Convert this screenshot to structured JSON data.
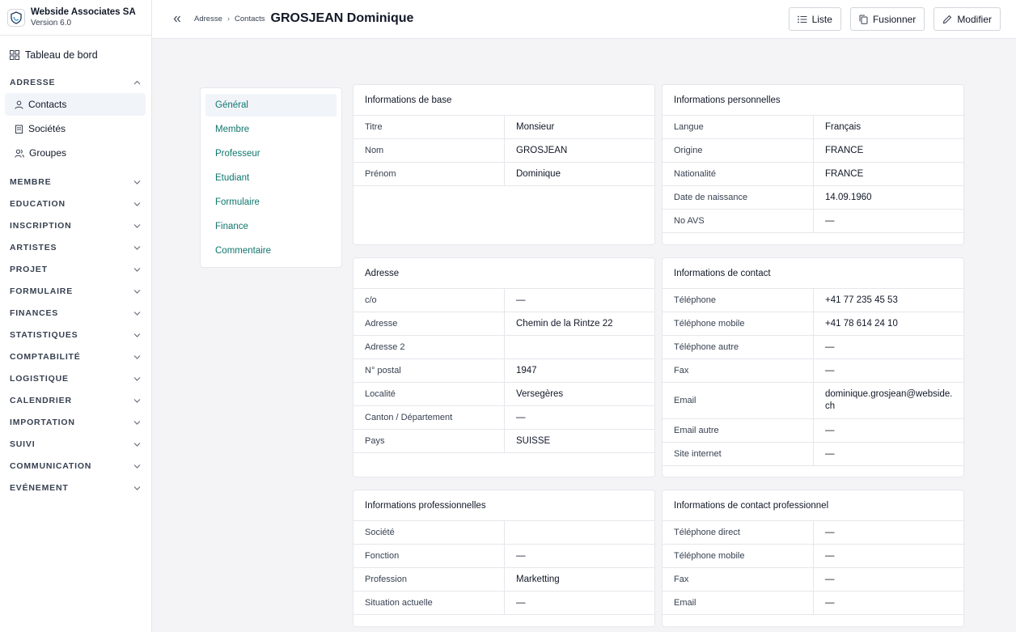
{
  "brand": {
    "name": "Webside Associates SA",
    "version": "Version 6.0"
  },
  "sidebar": {
    "dashboard": "Tableau de bord",
    "sections_top": [
      {
        "label": "ADRESSE"
      }
    ],
    "adresse_items": [
      {
        "label": "Contacts"
      },
      {
        "label": "Sociétés"
      },
      {
        "label": "Groupes"
      }
    ],
    "sections": [
      {
        "label": "MEMBRE"
      },
      {
        "label": "EDUCATION"
      },
      {
        "label": "INSCRIPTION"
      },
      {
        "label": "ARTISTES"
      },
      {
        "label": "PROJET"
      },
      {
        "label": "FORMULAIRE"
      },
      {
        "label": "FINANCES"
      },
      {
        "label": "STATISTIQUES"
      },
      {
        "label": "COMPTABILITÉ"
      },
      {
        "label": "LOGISTIQUE"
      },
      {
        "label": "CALENDRIER"
      },
      {
        "label": "IMPORTATION"
      },
      {
        "label": "SUIVI"
      },
      {
        "label": "COMMUNICATION"
      },
      {
        "label": "EVÉNEMENT"
      }
    ]
  },
  "breadcrumb": {
    "items": [
      "Adresse",
      "Contacts"
    ],
    "title_last": "GROSJEAN",
    "title_first": "Dominique"
  },
  "toolbar": {
    "list_label": "Liste",
    "merge_label": "Fusionner",
    "edit_label": "Modifier"
  },
  "tabs": [
    "Général",
    "Membre",
    "Professeur",
    "Etudiant",
    "Formulaire",
    "Finance",
    "Commentaire"
  ],
  "cards": {
    "base": {
      "title": "Informations de base",
      "rows": [
        [
          "Titre",
          "Monsieur"
        ],
        [
          "Nom",
          "GROSJEAN"
        ],
        [
          "Prénom",
          "Dominique"
        ]
      ]
    },
    "personal": {
      "title": "Informations personnelles",
      "rows": [
        [
          "Langue",
          "Français"
        ],
        [
          "Origine",
          "FRANCE"
        ],
        [
          "Nationalité",
          "FRANCE"
        ],
        [
          "Date de naissance",
          "14.09.1960"
        ],
        [
          "No AVS",
          "—"
        ]
      ]
    },
    "address": {
      "title": "Adresse",
      "rows": [
        [
          "c/o",
          "—"
        ],
        [
          "Adresse",
          "Chemin de la Rintze 22"
        ],
        [
          "Adresse 2",
          ""
        ],
        [
          "N° postal",
          "1947"
        ],
        [
          "Localité",
          "Versegères"
        ],
        [
          "Canton / Département",
          "—"
        ],
        [
          "Pays",
          "SUISSE"
        ]
      ]
    },
    "contact": {
      "title": "Informations de contact",
      "rows": [
        [
          "Téléphone",
          "+41 77 235 45 53"
        ],
        [
          "Téléphone mobile",
          "+41 78 614 24 10"
        ],
        [
          "Téléphone autre",
          "—"
        ],
        [
          "Fax",
          "—"
        ],
        [
          "Email",
          "dominique.grosjean@webside.ch"
        ],
        [
          "Email autre",
          "—"
        ],
        [
          "Site internet",
          "—"
        ]
      ]
    },
    "professional": {
      "title": "Informations professionnelles",
      "rows": [
        [
          "Société",
          ""
        ],
        [
          "Fonction",
          "—"
        ],
        [
          "Profession",
          "Marketting"
        ],
        [
          "Situation actuelle",
          "—"
        ]
      ]
    },
    "pro_contact": {
      "title": "Informations de contact professionnel",
      "rows": [
        [
          "Téléphone direct",
          "—"
        ],
        [
          "Téléphone mobile",
          "—"
        ],
        [
          "Fax",
          "—"
        ],
        [
          "Email",
          "—"
        ]
      ]
    }
  }
}
